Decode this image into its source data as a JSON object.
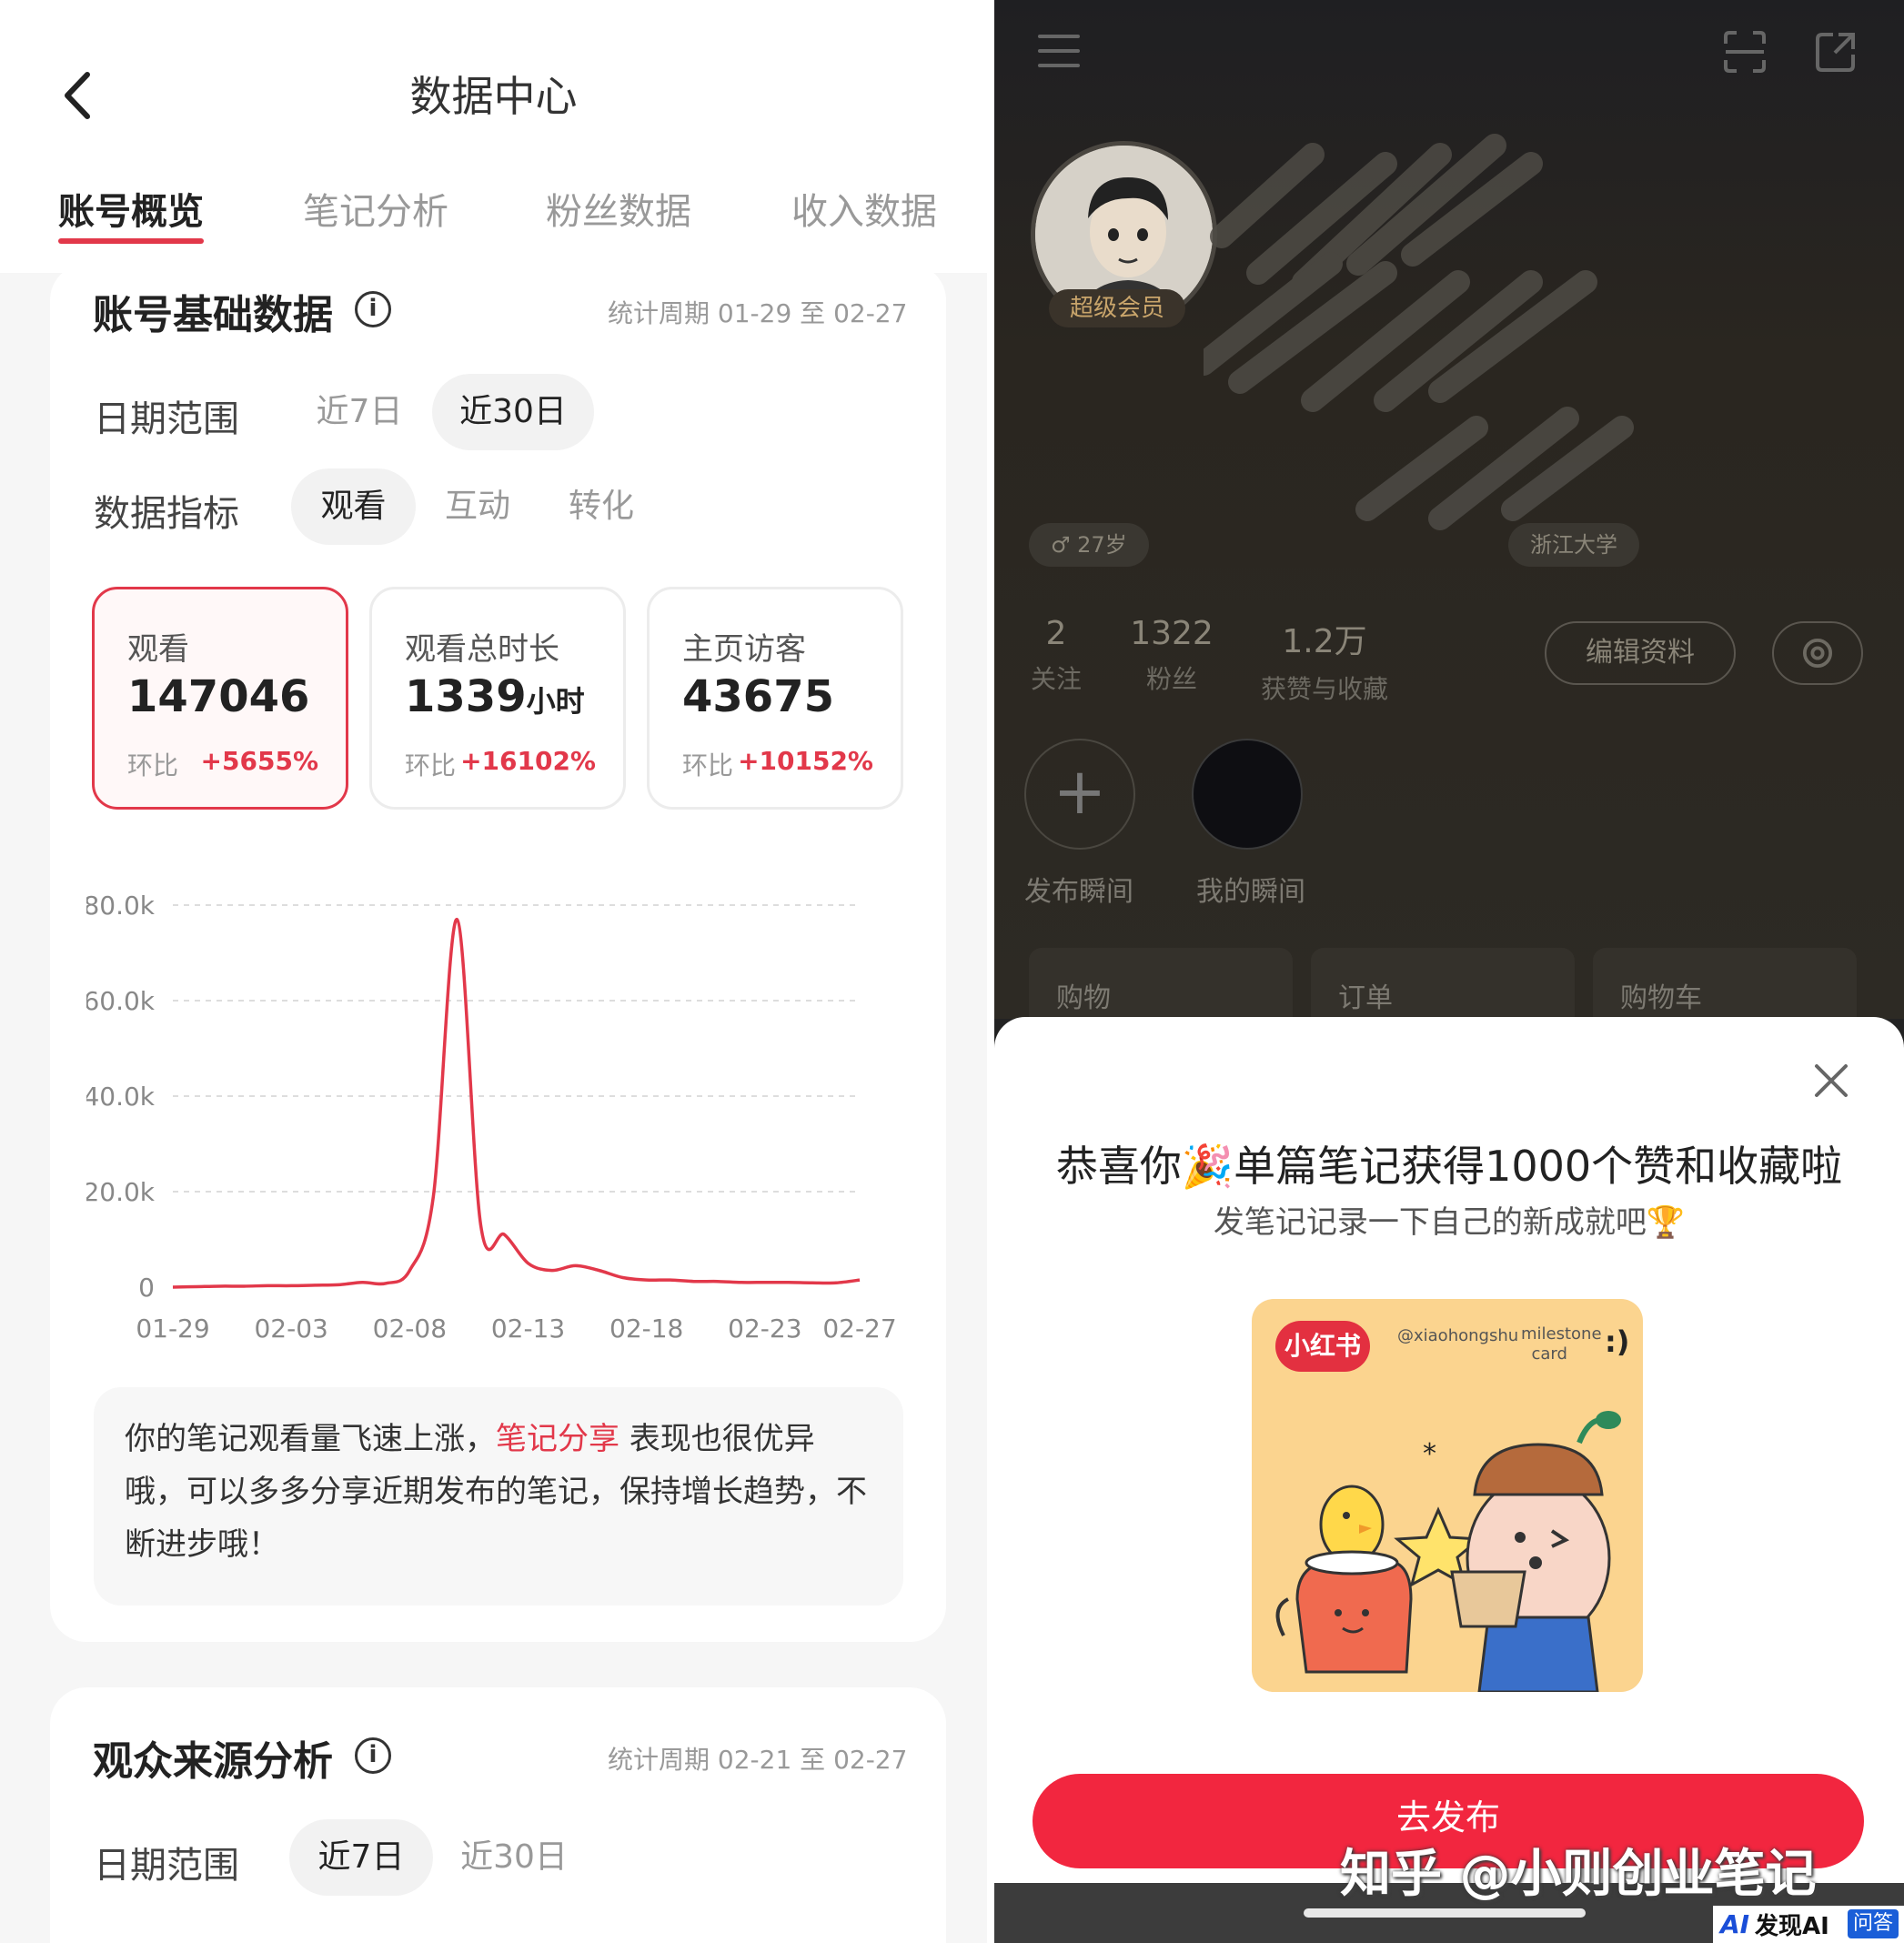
{
  "left": {
    "title": "数据中心",
    "tabs": [
      "账号概览",
      "笔记分析",
      "粉丝数据",
      "收入数据"
    ],
    "section1": {
      "title": "账号基础数据",
      "info": "i",
      "period": "统计周期 01-29 至 02-27",
      "date_label": "日期范围",
      "date_options": [
        "近7日",
        "近30日"
      ],
      "metric_label": "数据指标",
      "metric_options": [
        "观看",
        "互动",
        "转化"
      ],
      "metrics": [
        {
          "label": "观看",
          "value": "147046",
          "unit": "",
          "cmp": "环比",
          "pct": "+5655%"
        },
        {
          "label": "观看总时长",
          "value": "1339",
          "unit": "小时",
          "cmp": "环比",
          "pct": "+16102%"
        },
        {
          "label": "主页访客",
          "value": "43675",
          "unit": "",
          "cmp": "环比",
          "pct": "+10152%"
        }
      ],
      "tip_pre": "你的笔记观看量飞速上涨，",
      "tip_hl": "笔记分享",
      "tip_post": " 表现也很优异哦，可以多多分享近期发布的笔记，保持增长趋势，不断进步哦！"
    },
    "section2": {
      "title": "观众来源分析",
      "info": "i",
      "period": "统计周期 02-21 至 02-27",
      "date_label": "日期范围",
      "date_options": [
        "近7日",
        "近30日"
      ]
    }
  },
  "chart_data": {
    "type": "line",
    "title": "",
    "xlabel": "",
    "ylabel": "",
    "color": "#e2384a",
    "ylim": [
      0,
      80000
    ],
    "yticks": [
      0,
      20000,
      40000,
      60000,
      80000
    ],
    "ytick_labels": [
      "0",
      "20.0k",
      "40.0k",
      "60.0k",
      "80.0k"
    ],
    "xtick_labels": [
      "01-29",
      "02-03",
      "02-08",
      "02-13",
      "02-18",
      "02-23",
      "02-27"
    ],
    "xtick_index": [
      0,
      5,
      10,
      15,
      20,
      25,
      29
    ],
    "grid": true,
    "x": [
      "01-29",
      "01-30",
      "01-31",
      "02-01",
      "02-02",
      "02-03",
      "02-04",
      "02-05",
      "02-06",
      "02-07",
      "02-08",
      "02-09",
      "02-10",
      "02-11",
      "02-12",
      "02-13",
      "02-14",
      "02-15",
      "02-16",
      "02-17",
      "02-18",
      "02-19",
      "02-20",
      "02-21",
      "02-22",
      "02-23",
      "02-24",
      "02-25",
      "02-26",
      "02-27"
    ],
    "values": [
      0,
      100,
      200,
      200,
      300,
      300,
      400,
      500,
      1000,
      800,
      3500,
      19000,
      77000,
      13000,
      11000,
      5000,
      3500,
      4500,
      3500,
      2000,
      1500,
      1500,
      1200,
      1200,
      1000,
      1000,
      1000,
      900,
      900,
      1500
    ]
  },
  "right": {
    "vip": "超级会员",
    "tags": [
      "27岁",
      "浙江大学"
    ],
    "stats": [
      {
        "value": "2",
        "label": "关注"
      },
      {
        "value": "1322",
        "label": "粉丝"
      },
      {
        "value": "1.2万",
        "label": "获赞与收藏"
      }
    ],
    "edit": "编辑资料",
    "moments": [
      "发布瞬间",
      "我的瞬间"
    ],
    "shop": [
      "购物",
      "订单",
      "购物车"
    ],
    "modal": {
      "title": "恭喜你🎉单篇笔记获得1000个赞和收藏啦",
      "subtitle": "发笔记记录一下自己的新成就吧🏆",
      "card_brand": "小红书",
      "card_handle": "@xiaohongshu",
      "card_label1": "milestone",
      "card_label2": "card",
      "card_smile": ":)",
      "button": "去发布"
    },
    "watermark": "知乎 @小则创业笔记",
    "logo": {
      "ai": "AI",
      "text": "发现AI",
      "badge": "问答"
    }
  }
}
